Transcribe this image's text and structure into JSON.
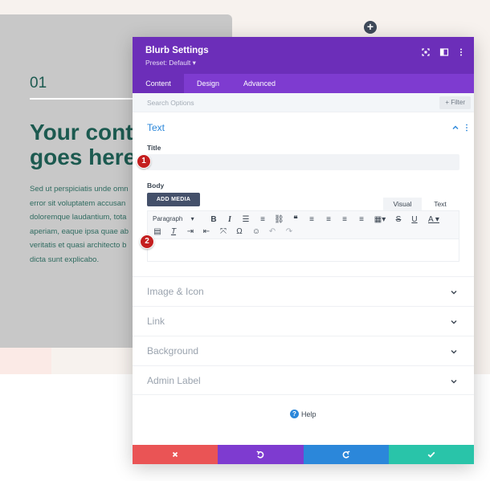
{
  "page": {
    "card": {
      "number": "01",
      "heading": "Your cont\ngoes here",
      "body": "Sed ut perspiciatis unde omn\nerror sit voluptatem accusan\ndoloremque laudantium, tota\naperiam, eaque ipsa quae ab\nveritatis et quasi architecto b\ndicta sunt explicabo."
    },
    "add_button": "+"
  },
  "modal": {
    "title": "Blurb Settings",
    "preset": "Preset: Default ▾",
    "tabs": [
      {
        "label": "Content",
        "active": true
      },
      {
        "label": "Design",
        "active": false
      },
      {
        "label": "Advanced",
        "active": false
      }
    ],
    "search": {
      "placeholder": "Search Options",
      "filter_label": "+ Filter"
    },
    "text_section": {
      "title": "Text",
      "title_field_label": "Title",
      "title_value": "",
      "body_field_label": "Body",
      "add_media_label": "ADD MEDIA",
      "editor_tabs": [
        "Visual",
        "Text"
      ],
      "format_select": "Paragraph",
      "body_value": ""
    },
    "badges": [
      "1",
      "2"
    ],
    "collapsed_sections": [
      "Image & Icon",
      "Link",
      "Background",
      "Admin Label"
    ],
    "help_label": "Help",
    "footer_colors": {
      "cancel": "#ea5455",
      "undo": "#7e3bd0",
      "redo": "#2b87da",
      "save": "#29c4a9"
    },
    "colors": {
      "header": "#6c2eb9",
      "tabs": "#7e3bd0",
      "accent": "#2b87da",
      "badge": "#c41f1f"
    }
  }
}
